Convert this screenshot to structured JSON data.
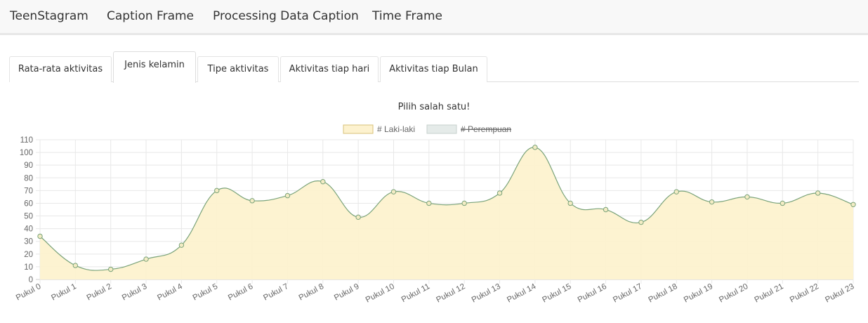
{
  "navbar": {
    "brand": "TeenStagram",
    "items": [
      "Caption Frame",
      "Processing Data Caption",
      "Time Frame"
    ]
  },
  "tabs": [
    {
      "label": "Rata-rata aktivitas",
      "active": false
    },
    {
      "label": "Jenis kelamin",
      "active": true
    },
    {
      "label": "Tipe aktivitas",
      "active": false
    },
    {
      "label": "Aktivitas tiap hari",
      "active": false
    },
    {
      "label": "Aktivitas tiap Bulan",
      "active": false
    }
  ],
  "subtitle": "Pilih salah satu!",
  "chart_data": {
    "type": "area",
    "categories": [
      "Pukul 0",
      "Pukul 1",
      "Pukul 2",
      "Pukul 3",
      "Pukul 4",
      "Pukul 5",
      "Pukul 6",
      "Pukul 7",
      "Pukul 8",
      "Pukul 9",
      "Pukul 10",
      "Pukul 11",
      "Pukul 12",
      "Pukul 13",
      "Pukul 14",
      "Pukul 15",
      "Pukul 16",
      "Pukul 17",
      "Pukul 18",
      "Pukul 19",
      "Pukul 20",
      "Pukul 21",
      "Pukul 22",
      "Pukul 23"
    ],
    "series": [
      {
        "name": "# Laki-laki",
        "values": [
          34,
          11,
          8,
          16,
          27,
          70,
          62,
          66,
          77,
          49,
          69,
          60,
          60,
          68,
          104,
          60,
          55,
          45,
          69,
          61,
          65,
          60,
          68,
          59
        ],
        "fill": "#fdf2cf",
        "stroke": "#7aa37a",
        "hidden": false
      },
      {
        "name": "# Perempuan",
        "values": [],
        "fill": "#e5ebe9",
        "stroke": "#c7d1cd",
        "hidden": true
      }
    ],
    "ylim": [
      0,
      110
    ],
    "yticks": [
      0,
      10,
      20,
      30,
      40,
      50,
      60,
      70,
      80,
      90,
      100,
      110
    ],
    "grid": true,
    "legend": "top-center"
  }
}
